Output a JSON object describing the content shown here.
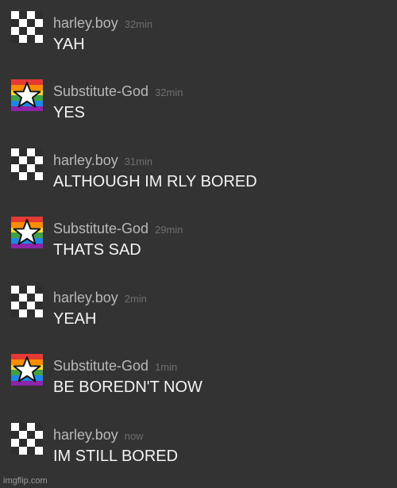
{
  "messages": [
    {
      "user": "harley.boy",
      "time": "32min",
      "text": "YAH",
      "avatar_icon": "checkered-avatar-icon"
    },
    {
      "user": "Substitute-God",
      "time": "32min",
      "text": "YES",
      "avatar_icon": "rainbow-star-avatar-icon"
    },
    {
      "user": "harley.boy",
      "time": "31min",
      "text": "ALTHOUGH IM RLY BORED",
      "avatar_icon": "checkered-avatar-icon"
    },
    {
      "user": "Substitute-God",
      "time": "29min",
      "text": "THATS SAD",
      "avatar_icon": "rainbow-star-avatar-icon"
    },
    {
      "user": "harley.boy",
      "time": "2min",
      "text": "YEAH",
      "avatar_icon": "checkered-avatar-icon"
    },
    {
      "user": "Substitute-God",
      "time": "1min",
      "text": "BE BOREDN'T NOW",
      "avatar_icon": "rainbow-star-avatar-icon"
    },
    {
      "user": "harley.boy",
      "time": "now",
      "text": "IM STILL BORED",
      "avatar_icon": "checkered-avatar-icon"
    }
  ],
  "watermark": "imgflip.com",
  "colors": {
    "background": "#333333",
    "username": "#b9b9b9",
    "timestamp": "#6f6f6f",
    "message_text": "#f4f4f4"
  }
}
